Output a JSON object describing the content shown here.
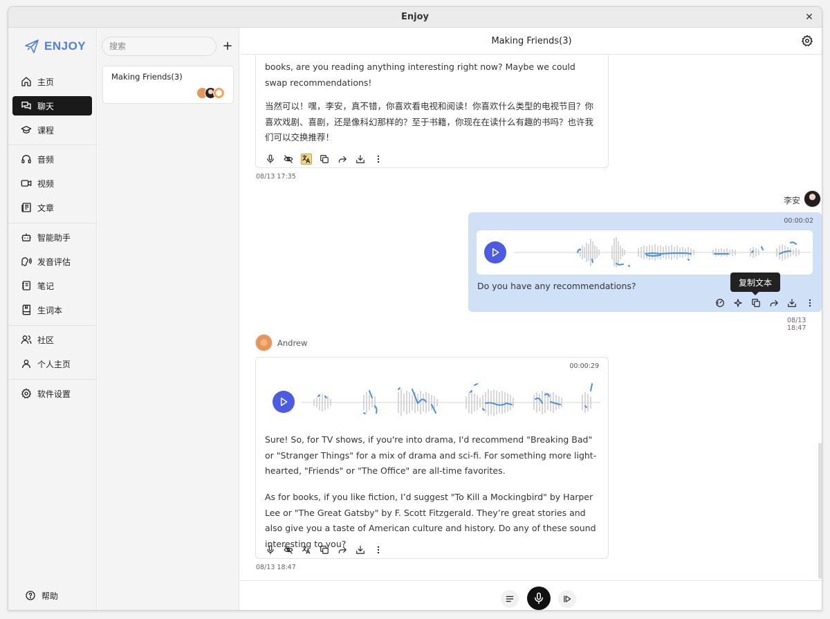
{
  "window": {
    "title": "Enjoy",
    "close_glyph": "✕"
  },
  "sidebar": {
    "logo_text": "ENJOY",
    "items": [
      {
        "label": "主页",
        "icon": "home-icon"
      },
      {
        "label": "聊天",
        "icon": "chat-icon",
        "active": true
      },
      {
        "label": "课程",
        "icon": "graduation-cap-icon"
      },
      {
        "label": "音频",
        "icon": "headphones-icon"
      },
      {
        "label": "视频",
        "icon": "video-icon"
      },
      {
        "label": "文章",
        "icon": "newspaper-icon"
      },
      {
        "label": "智能助手",
        "icon": "bot-icon"
      },
      {
        "label": "发音评估",
        "icon": "speech-icon"
      },
      {
        "label": "笔记",
        "icon": "notebook-icon"
      },
      {
        "label": "生词本",
        "icon": "book-icon"
      },
      {
        "label": "社区",
        "icon": "users-icon"
      },
      {
        "label": "个人主页",
        "icon": "user-icon"
      },
      {
        "label": "软件设置",
        "icon": "gear-icon"
      }
    ],
    "help_label": "帮助"
  },
  "conversations": {
    "search_placeholder": "搜索",
    "add_glyph": "+",
    "items": [
      {
        "name": "Making Friends(3)"
      }
    ]
  },
  "chat": {
    "title": "Making Friends(3)",
    "msg1": {
      "en_text": "books, are you reading anything interesting right now? Maybe we could swap recommendations!",
      "zh_text": "当然可以！嘿，李安，真不错，你喜欢看电视和阅读！你喜欢什么类型的电视节目？你喜欢戏剧、喜剧，还是像科幻那样的？至于书籍，你现在在读什么有趣的书吗？也许我们可以交换推荐！",
      "timestamp": "08/13 17:35"
    },
    "msg2": {
      "sender": "李安",
      "duration": "00:00:02",
      "text": "Do you have any recommendations?",
      "timestamp": "08/13 18:47",
      "tooltip": "复制文本"
    },
    "msg3": {
      "sender": "Andrew",
      "duration": "00:00:29",
      "para1": "Sure! So, for TV shows, if you're into drama, I'd recommend \"Breaking Bad\" or \"Stranger Things\" for a mix of drama and sci-fi. For something more light-hearted, \"Friends\" or \"The Office\" are all-time favorites.",
      "para2": "As for books, if you like fiction, I’d suggest \"To Kill a Mockingbird\" by Harper Lee or \"The Great Gatsby\" by F. Scott Fitzgerald. They’re great stories and also give you a taste of American culture and history. Do any of these sound interesting to you?",
      "timestamp": "08/13 18:47"
    }
  },
  "colors": {
    "accent": "#4b5be3",
    "user_bubble": "#cfe0f7",
    "pitch": "#4a90d9",
    "active_nav": "#1a1a1a"
  }
}
